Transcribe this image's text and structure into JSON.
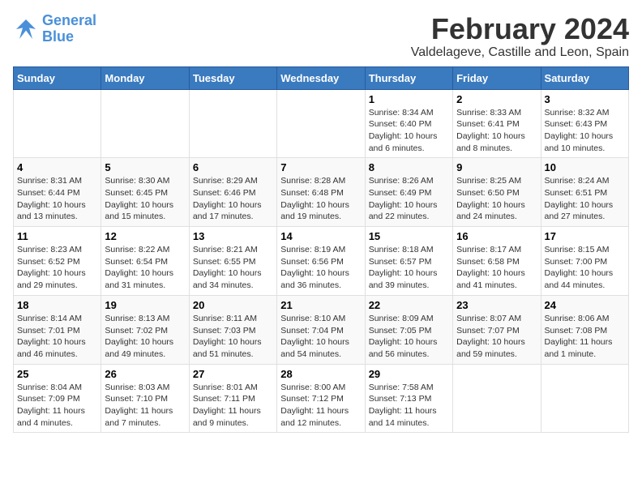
{
  "header": {
    "logo_line1": "General",
    "logo_line2": "Blue",
    "main_title": "February 2024",
    "sub_title": "Valdelageve, Castille and Leon, Spain"
  },
  "days_of_week": [
    "Sunday",
    "Monday",
    "Tuesday",
    "Wednesday",
    "Thursday",
    "Friday",
    "Saturday"
  ],
  "weeks": [
    [
      {
        "day": "",
        "info": ""
      },
      {
        "day": "",
        "info": ""
      },
      {
        "day": "",
        "info": ""
      },
      {
        "day": "",
        "info": ""
      },
      {
        "day": "1",
        "info": "Sunrise: 8:34 AM\nSunset: 6:40 PM\nDaylight: 10 hours\nand 6 minutes."
      },
      {
        "day": "2",
        "info": "Sunrise: 8:33 AM\nSunset: 6:41 PM\nDaylight: 10 hours\nand 8 minutes."
      },
      {
        "day": "3",
        "info": "Sunrise: 8:32 AM\nSunset: 6:43 PM\nDaylight: 10 hours\nand 10 minutes."
      }
    ],
    [
      {
        "day": "4",
        "info": "Sunrise: 8:31 AM\nSunset: 6:44 PM\nDaylight: 10 hours\nand 13 minutes."
      },
      {
        "day": "5",
        "info": "Sunrise: 8:30 AM\nSunset: 6:45 PM\nDaylight: 10 hours\nand 15 minutes."
      },
      {
        "day": "6",
        "info": "Sunrise: 8:29 AM\nSunset: 6:46 PM\nDaylight: 10 hours\nand 17 minutes."
      },
      {
        "day": "7",
        "info": "Sunrise: 8:28 AM\nSunset: 6:48 PM\nDaylight: 10 hours\nand 19 minutes."
      },
      {
        "day": "8",
        "info": "Sunrise: 8:26 AM\nSunset: 6:49 PM\nDaylight: 10 hours\nand 22 minutes."
      },
      {
        "day": "9",
        "info": "Sunrise: 8:25 AM\nSunset: 6:50 PM\nDaylight: 10 hours\nand 24 minutes."
      },
      {
        "day": "10",
        "info": "Sunrise: 8:24 AM\nSunset: 6:51 PM\nDaylight: 10 hours\nand 27 minutes."
      }
    ],
    [
      {
        "day": "11",
        "info": "Sunrise: 8:23 AM\nSunset: 6:52 PM\nDaylight: 10 hours\nand 29 minutes."
      },
      {
        "day": "12",
        "info": "Sunrise: 8:22 AM\nSunset: 6:54 PM\nDaylight: 10 hours\nand 31 minutes."
      },
      {
        "day": "13",
        "info": "Sunrise: 8:21 AM\nSunset: 6:55 PM\nDaylight: 10 hours\nand 34 minutes."
      },
      {
        "day": "14",
        "info": "Sunrise: 8:19 AM\nSunset: 6:56 PM\nDaylight: 10 hours\nand 36 minutes."
      },
      {
        "day": "15",
        "info": "Sunrise: 8:18 AM\nSunset: 6:57 PM\nDaylight: 10 hours\nand 39 minutes."
      },
      {
        "day": "16",
        "info": "Sunrise: 8:17 AM\nSunset: 6:58 PM\nDaylight: 10 hours\nand 41 minutes."
      },
      {
        "day": "17",
        "info": "Sunrise: 8:15 AM\nSunset: 7:00 PM\nDaylight: 10 hours\nand 44 minutes."
      }
    ],
    [
      {
        "day": "18",
        "info": "Sunrise: 8:14 AM\nSunset: 7:01 PM\nDaylight: 10 hours\nand 46 minutes."
      },
      {
        "day": "19",
        "info": "Sunrise: 8:13 AM\nSunset: 7:02 PM\nDaylight: 10 hours\nand 49 minutes."
      },
      {
        "day": "20",
        "info": "Sunrise: 8:11 AM\nSunset: 7:03 PM\nDaylight: 10 hours\nand 51 minutes."
      },
      {
        "day": "21",
        "info": "Sunrise: 8:10 AM\nSunset: 7:04 PM\nDaylight: 10 hours\nand 54 minutes."
      },
      {
        "day": "22",
        "info": "Sunrise: 8:09 AM\nSunset: 7:05 PM\nDaylight: 10 hours\nand 56 minutes."
      },
      {
        "day": "23",
        "info": "Sunrise: 8:07 AM\nSunset: 7:07 PM\nDaylight: 10 hours\nand 59 minutes."
      },
      {
        "day": "24",
        "info": "Sunrise: 8:06 AM\nSunset: 7:08 PM\nDaylight: 11 hours\nand 1 minute."
      }
    ],
    [
      {
        "day": "25",
        "info": "Sunrise: 8:04 AM\nSunset: 7:09 PM\nDaylight: 11 hours\nand 4 minutes."
      },
      {
        "day": "26",
        "info": "Sunrise: 8:03 AM\nSunset: 7:10 PM\nDaylight: 11 hours\nand 7 minutes."
      },
      {
        "day": "27",
        "info": "Sunrise: 8:01 AM\nSunset: 7:11 PM\nDaylight: 11 hours\nand 9 minutes."
      },
      {
        "day": "28",
        "info": "Sunrise: 8:00 AM\nSunset: 7:12 PM\nDaylight: 11 hours\nand 12 minutes."
      },
      {
        "day": "29",
        "info": "Sunrise: 7:58 AM\nSunset: 7:13 PM\nDaylight: 11 hours\nand 14 minutes."
      },
      {
        "day": "",
        "info": ""
      },
      {
        "day": "",
        "info": ""
      }
    ]
  ]
}
